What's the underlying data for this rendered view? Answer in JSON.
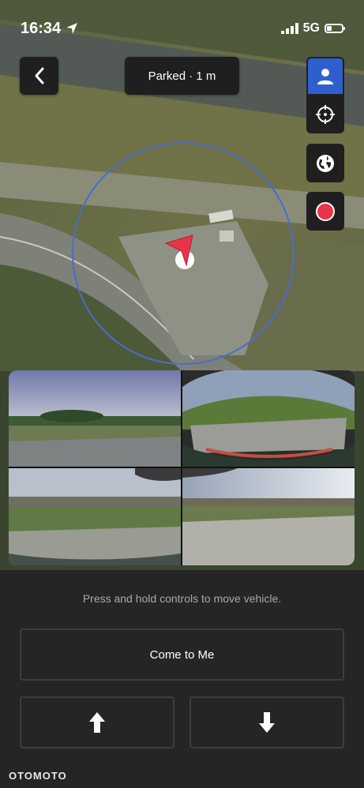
{
  "status_bar": {
    "time": "16:34",
    "network": "5G",
    "battery_level": 0.35
  },
  "header": {
    "status_text": "Parked · 1 m"
  },
  "icons": {
    "back": "chevron-left-icon",
    "location": "location-arrow-icon",
    "signal": "signal-bars-icon",
    "battery": "battery-icon",
    "person": "person-icon",
    "recenter": "crosshair-icon",
    "globe": "globe-icon",
    "record": "record-icon",
    "vehicle": "vehicle-pointer-icon",
    "forward": "arrow-up-icon",
    "reverse": "arrow-down-icon"
  },
  "colors": {
    "accent": "#2f5fcf",
    "record": "#e8344a",
    "range_circle": "#4a6bd0",
    "vehicle_pointer": "#e8344a"
  },
  "controls": {
    "hint": "Press and hold controls to move vehicle.",
    "come_to_me": "Come to Me"
  },
  "watermark": "OTOMOTO"
}
